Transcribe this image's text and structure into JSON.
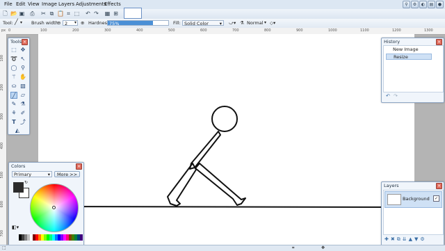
{
  "menu": {
    "file": "File",
    "edit": "Edit",
    "view": "View",
    "image": "Image",
    "layers": "Layers",
    "adjustments": "Adjustments",
    "effects": "Effects"
  },
  "options": {
    "tool_label": "Tool:",
    "brush_width_label": "Brush width:",
    "brush_width_value": "2",
    "hardness_label": "Hardness:",
    "hardness_value": "75%",
    "hardness_fraction": 0.75,
    "fill_label": "Fill:",
    "fill_value": "Solid Color",
    "blend_mode": "Normal"
  },
  "ruler": {
    "top_ticks": [
      "0",
      "100",
      "200",
      "300",
      "400",
      "500",
      "600",
      "700",
      "800",
      "900",
      "1000",
      "1100",
      "1200",
      "1300"
    ],
    "left_ticks": [
      "100",
      "200",
      "300",
      "400",
      "500",
      "600",
      "700"
    ]
  },
  "tools_panel": {
    "title": "Tools"
  },
  "colors_panel": {
    "title": "Colors",
    "mode": "Primary",
    "more_button": "More >>",
    "primary_color": "#2b2b2b",
    "secondary_color": "#ffffff"
  },
  "history_panel": {
    "title": "History",
    "items": [
      {
        "label": "New Image"
      },
      {
        "label": "Resize"
      }
    ]
  },
  "layers_panel": {
    "title": "Layers",
    "layers": [
      {
        "name": "Background",
        "visible": true
      }
    ]
  },
  "colors": {
    "accent": "#4a8fd6",
    "chrome": "#dce7f3",
    "canvas_bg": "#ffffff",
    "workspace": "#b4b4b4"
  }
}
